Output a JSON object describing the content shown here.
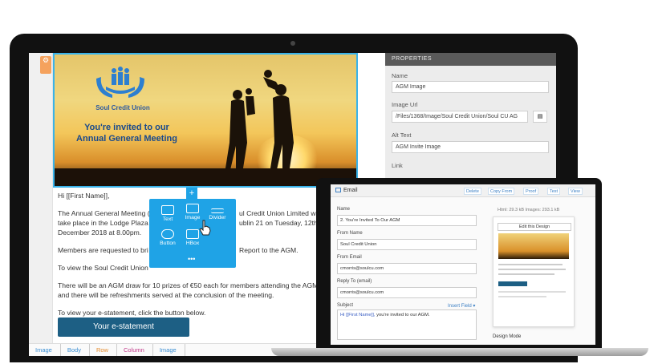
{
  "editor": {
    "rail_icon": "gear-icon",
    "hero": {
      "logo_text": "Soul Credit Union",
      "title_line1": "You're invited to our",
      "title_line2": "Annual General Meeting"
    },
    "lines": [
      "Hi [[First Name]],",
      "The Annual General Meeting (",
      "take place in the Lodge Plaza",
      "December 2018 at 8.00pm.",
      "Members are requested to bri",
      "To view the Soul Credit Union",
      "There will be an AGM draw for 10 prizes of €50 each for members attending the AGM",
      "and there will be refreshments served at the conclusion of the meeting.",
      "To view your e-statement, click the button below."
    ],
    "lines_right": [
      "ul Credit Union Limited will",
      "ublin 21 on Tuesday, 12th",
      "Report to the AGM."
    ],
    "button_label": "Your e-statement",
    "breadcrumb": [
      "Image",
      "Body",
      "Row",
      "Column",
      "Image"
    ]
  },
  "palette": {
    "plus": "+",
    "items": [
      {
        "label": "Text",
        "icon": "text-block-icon"
      },
      {
        "label": "Image",
        "icon": "image-icon"
      },
      {
        "label": "Divider",
        "icon": "divider-icon"
      },
      {
        "label": "Button",
        "icon": "button-icon"
      },
      {
        "label": "HBox",
        "icon": "hbox-icon"
      }
    ],
    "more": "•••"
  },
  "properties": {
    "header": "PROPERTIES",
    "name_label": "Name",
    "name_value": "AGM Image",
    "url_label": "Image Url",
    "url_value": "/Files/1368/Image/Soul Credit Union/Soul CU AG",
    "alt_label": "Alt Text",
    "alt_value": "AGM Invite Image",
    "link_label": "Link"
  },
  "email_app": {
    "title": "Email",
    "actions": [
      "Delete",
      "Copy From",
      "Proof",
      "Test",
      "View"
    ],
    "name_label": "Name",
    "name_value": "2. You're Invited To Our AGM",
    "from_name_label": "From Name",
    "from_name_value": "Soul Credit Union",
    "from_email_label": "From Email",
    "from_email_value": "cmorris@soulcu.com",
    "reply_label": "Reply To (email)",
    "reply_value": "cmorris@soulcu.com",
    "subject_label": "Subject",
    "insert_field": "Insert Field",
    "subject_value_tag": "Hi [[First Name]],",
    "subject_value_rest": " you're invited to our AGM.",
    "stats": "Html: 29.3 kB    Images: 293.1 kB",
    "edit_design": "Edit this Design",
    "design_mode": "Design Mode"
  }
}
